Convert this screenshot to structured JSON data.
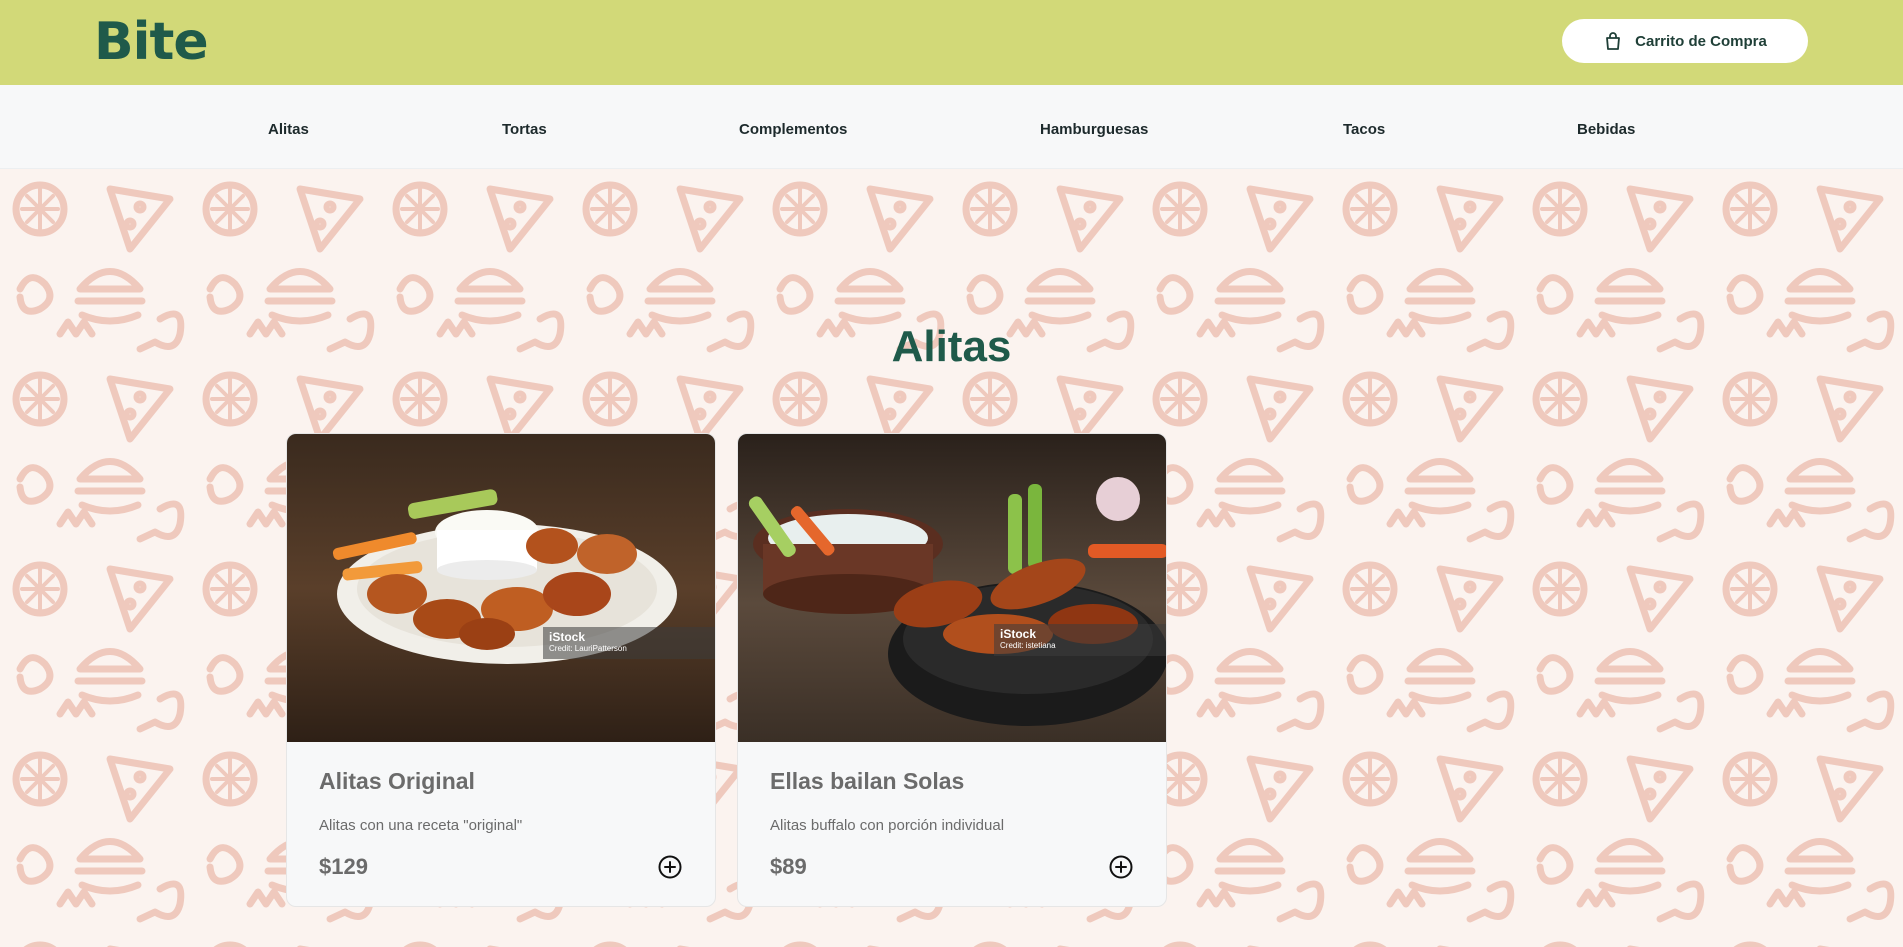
{
  "header": {
    "logo": "Bite",
    "cart_label": "Carrito de Compra"
  },
  "categories": [
    "Alitas",
    "Tortas",
    "Complementos",
    "Hamburguesas",
    "Tacos",
    "Bebidas"
  ],
  "section": {
    "title": "Alitas"
  },
  "products": [
    {
      "name": "Alitas Original",
      "description": "Alitas con una receta \"original\"",
      "price": "$129",
      "watermark_brand": "iStock",
      "watermark_credit": "Credit: LauriPatterson"
    },
    {
      "name": "Ellas bailan Solas",
      "description": "Alitas buffalo con porción individual",
      "price": "$89",
      "watermark_brand": "iStock",
      "watermark_credit": "Credit: istetiana"
    }
  ],
  "colors": {
    "header_bg": "#d2d978",
    "brand_green": "#1f5a4a",
    "pattern_ink": "#efc9bd"
  },
  "icons": {
    "cart": "shopping-bag-icon",
    "add": "plus-circle-icon"
  }
}
